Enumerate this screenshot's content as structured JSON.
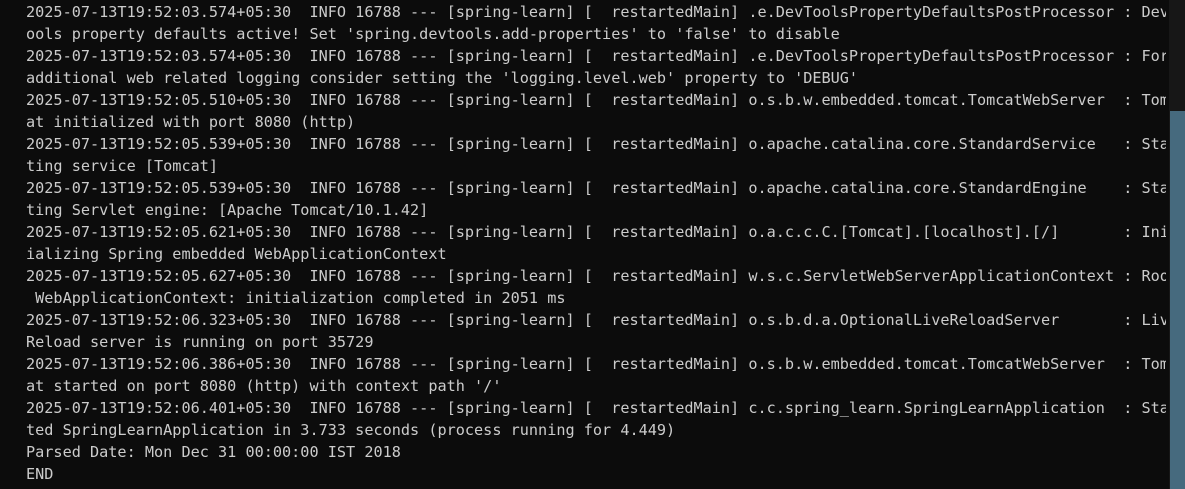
{
  "console": {
    "lines": [
      "2025-07-13T19:52:03.574+05:30  INFO 16788 --- [spring-learn] [  restartedMain] .e.DevToolsPropertyDefaultsPostProcessor : Devt",
      "ools property defaults active! Set 'spring.devtools.add-properties' to 'false' to disable",
      "2025-07-13T19:52:03.574+05:30  INFO 16788 --- [spring-learn] [  restartedMain] .e.DevToolsPropertyDefaultsPostProcessor : For",
      "additional web related logging consider setting the 'logging.level.web' property to 'DEBUG'",
      "2025-07-13T19:52:05.510+05:30  INFO 16788 --- [spring-learn] [  restartedMain] o.s.b.w.embedded.tomcat.TomcatWebServer  : Tomc",
      "at initialized with port 8080 (http)",
      "2025-07-13T19:52:05.539+05:30  INFO 16788 --- [spring-learn] [  restartedMain] o.apache.catalina.core.StandardService   : Star",
      "ting service [Tomcat]",
      "2025-07-13T19:52:05.539+05:30  INFO 16788 --- [spring-learn] [  restartedMain] o.apache.catalina.core.StandardEngine    : Star",
      "ting Servlet engine: [Apache Tomcat/10.1.42]",
      "2025-07-13T19:52:05.621+05:30  INFO 16788 --- [spring-learn] [  restartedMain] o.a.c.c.C.[Tomcat].[localhost].[/]       : Init",
      "ializing Spring embedded WebApplicationContext",
      "2025-07-13T19:52:05.627+05:30  INFO 16788 --- [spring-learn] [  restartedMain] w.s.c.ServletWebServerApplicationContext : Root",
      " WebApplicationContext: initialization completed in 2051 ms",
      "2025-07-13T19:52:06.323+05:30  INFO 16788 --- [spring-learn] [  restartedMain] o.s.b.d.a.OptionalLiveReloadServer       : Live",
      "Reload server is running on port 35729",
      "2025-07-13T19:52:06.386+05:30  INFO 16788 --- [spring-learn] [  restartedMain] o.s.b.w.embedded.tomcat.TomcatWebServer  : Tomc",
      "at started on port 8080 (http) with context path '/'",
      "2025-07-13T19:52:06.401+05:30  INFO 16788 --- [spring-learn] [  restartedMain] c.c.spring_learn.SpringLearnApplication  : Star",
      "ted SpringLearnApplication in 3.733 seconds (process running for 4.449)",
      "Parsed Date: Mon Dec 31 00:00:00 IST 2018",
      "END"
    ]
  },
  "colors": {
    "background": "#0c0c0c",
    "text": "#cccccc",
    "scrollbar_track": "#171717",
    "scrollbar_thumb": "#466a7e"
  }
}
